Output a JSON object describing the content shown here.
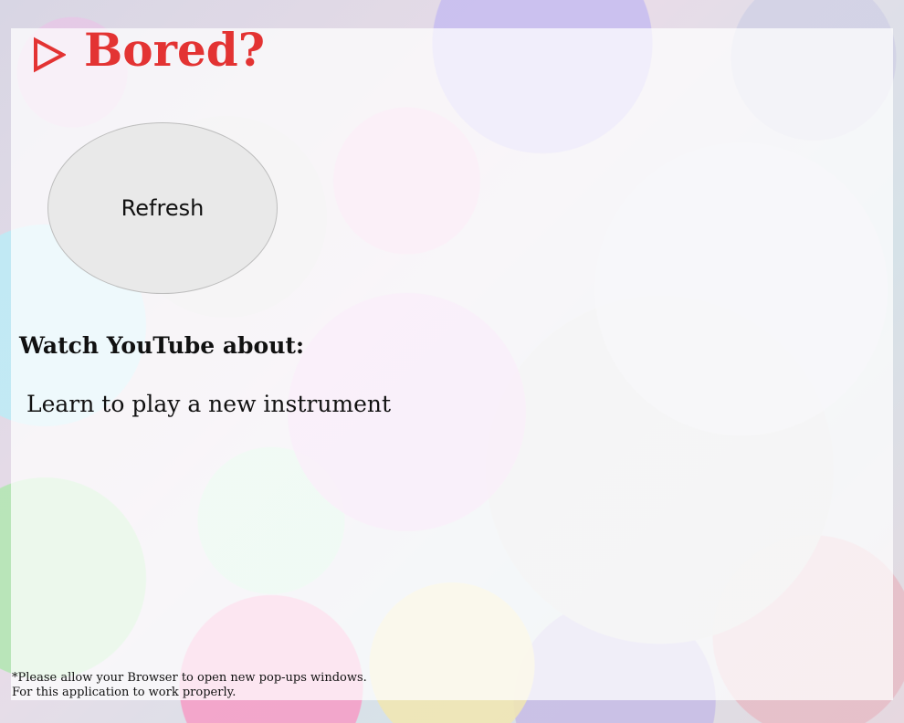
{
  "header": {
    "title": "Bored?",
    "icon": "play-outline-icon",
    "title_color": "#e33333"
  },
  "refresh": {
    "label": "Refresh"
  },
  "main": {
    "heading": "Watch YouTube about:",
    "suggestion": "Learn to play a new instrument"
  },
  "footer": {
    "line1": "*Please allow your Browser to open new pop-ups windows.",
    "line2": "For this application to work properly."
  }
}
